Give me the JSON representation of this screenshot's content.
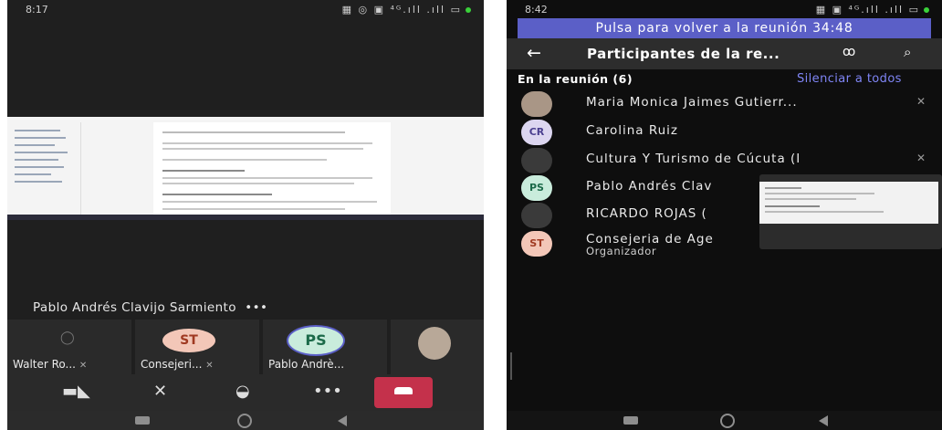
{
  "phone1": {
    "status": {
      "time": "8:17",
      "icons": "▦ ◎ ▣ ⁴ᴳ.ıll .ıll ▭"
    },
    "speaker_name": "Pablo Andrés Clavijo Sarmiento",
    "more_label": "•••",
    "tiles": [
      {
        "label": "Walter Ro...",
        "icon": "person-icon"
      },
      {
        "label": "Consejeri...",
        "initials": "ST"
      },
      {
        "label": "Pablo Andrè...",
        "initials": "PS"
      },
      {
        "label": "",
        "icon": "photo-avatar"
      }
    ],
    "toolbar": {
      "more": "•••"
    }
  },
  "phone2": {
    "status": {
      "time": "8:42",
      "icons": "▦ ▣ ⁴ᴳ.ıll .ıll ▭"
    },
    "return_banner": "Pulsa para volver a la reunión 34:48",
    "header_title": "Participantes de la re...",
    "section_label": "En la reunión (6)",
    "mute_all": "Silenciar a todos",
    "participants": [
      {
        "initials": "",
        "name": "Maria Monica Jaimes Gutierr...",
        "muted": true
      },
      {
        "initials": "CR",
        "name": "Carolina Ruiz",
        "muted": false
      },
      {
        "initials": "",
        "name": "Cultura Y Turismo de Cúcuta  (I",
        "muted": true
      },
      {
        "initials": "PS",
        "name": "Pablo Andrés Clav",
        "muted": false
      },
      {
        "initials": "",
        "name": "RICARDO ROJAS (",
        "muted": false
      },
      {
        "initials": "ST",
        "name": "Consejeria de Age",
        "role": "Organizador",
        "muted": false
      }
    ]
  },
  "colors": {
    "teams_purple": "#5b5fc7",
    "hangup_red": "#c4314b",
    "link": "#7f85f5"
  }
}
